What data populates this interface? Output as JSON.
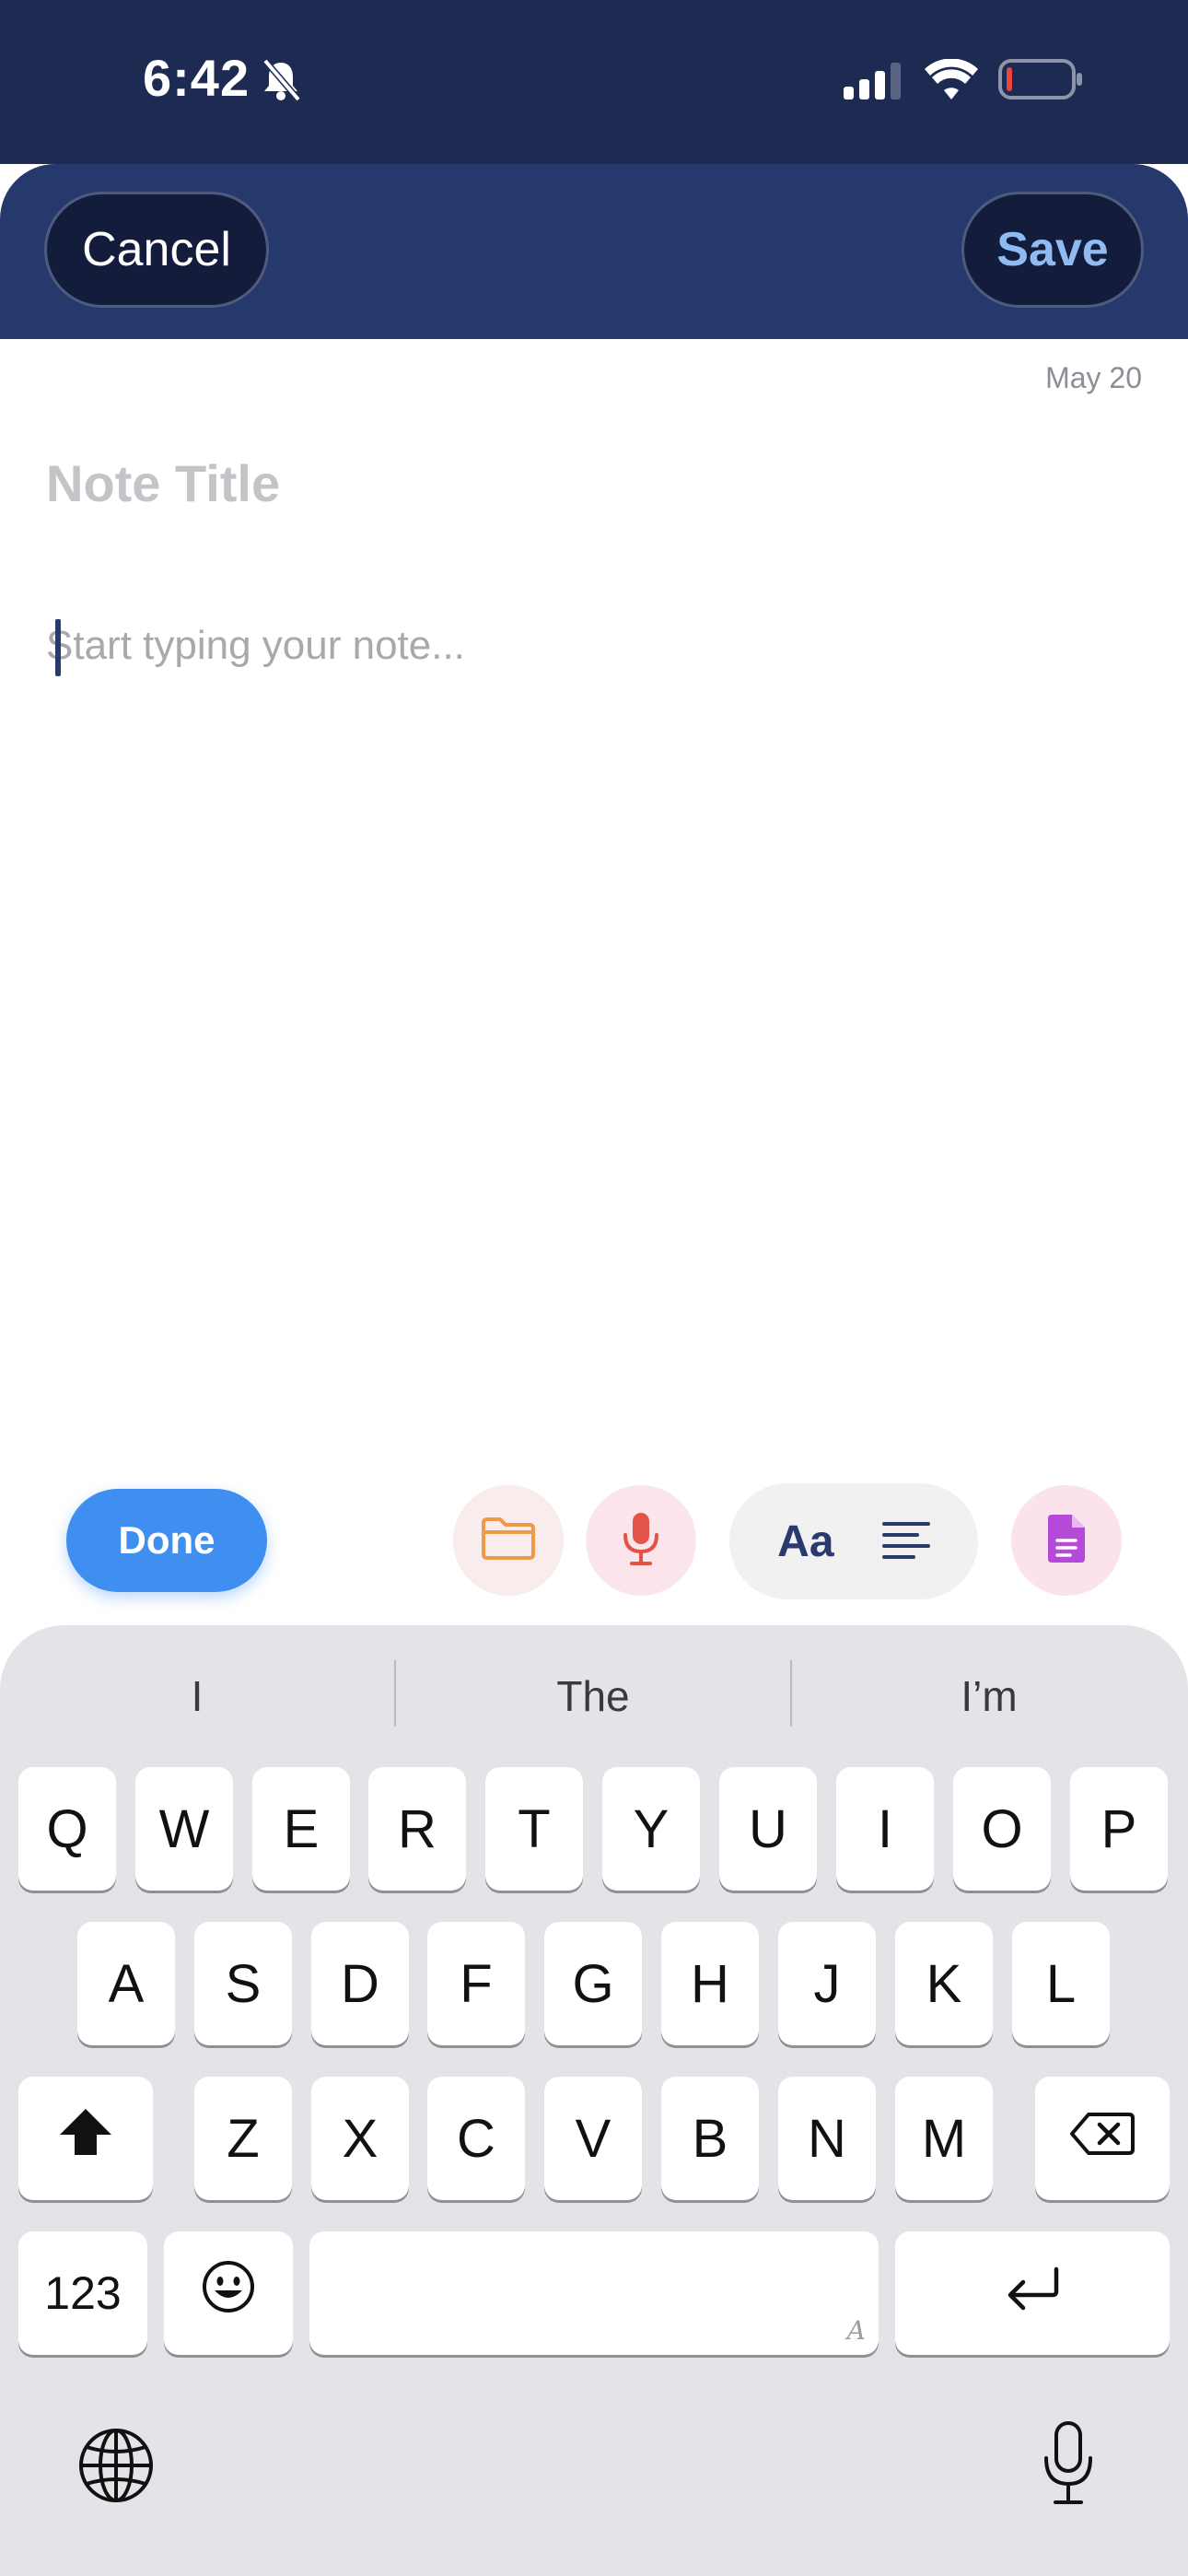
{
  "status_bar": {
    "time": "6:42",
    "icons": [
      "bell-slash-icon",
      "cellular-signal-icon",
      "wifi-icon",
      "battery-low-icon"
    ]
  },
  "header": {
    "cancel_label": "Cancel",
    "save_label": "Save"
  },
  "note": {
    "date": "May 20",
    "title_placeholder": "Note Title",
    "body_placeholder": "Start typing your note..."
  },
  "toolbar": {
    "done_label": "Done",
    "format_label": "Aa",
    "icons": [
      "folder-icon",
      "microphone-icon",
      "align-left-icon",
      "document-icon"
    ]
  },
  "keyboard": {
    "suggestions": [
      "I",
      "The",
      "I’m"
    ],
    "row1": [
      "Q",
      "W",
      "E",
      "R",
      "T",
      "Y",
      "U",
      "I",
      "O",
      "P"
    ],
    "row2": [
      "A",
      "S",
      "D",
      "F",
      "G",
      "H",
      "J",
      "K",
      "L"
    ],
    "row3": [
      "Z",
      "X",
      "C",
      "V",
      "B",
      "N",
      "M"
    ],
    "numbers_label": "123",
    "space_hint": "A"
  },
  "colors": {
    "header_bg": "#26396d",
    "status_bg": "#1d2a52",
    "accent_blue": "#3f8ff0",
    "save_text": "#8fbbf2",
    "folder_orange": "#ef9a4a",
    "mic_red": "#e2534a",
    "doc_purple": "#b64ad8"
  }
}
